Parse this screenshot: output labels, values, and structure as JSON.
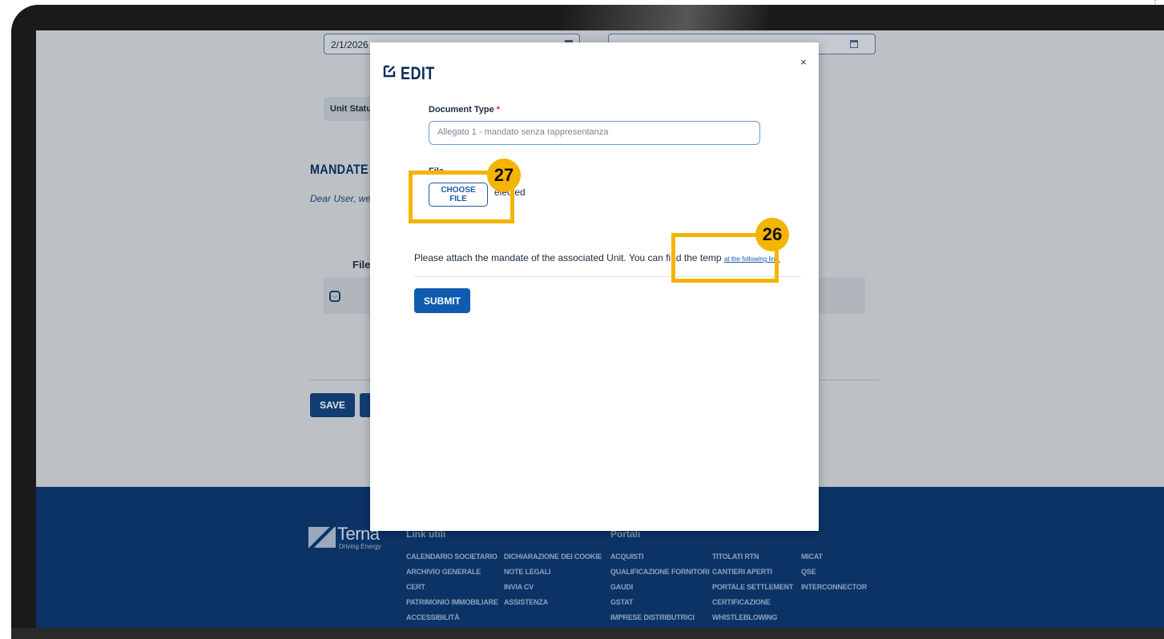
{
  "background_page": {
    "date_from": "2/1/2026",
    "unit_status_label": "Unit Status:",
    "mandate_title": "MANDATE",
    "mandate_note": "Dear User, werem",
    "table_col_file": "File",
    "save_label": "SAVE"
  },
  "modal": {
    "title": "EDIT",
    "close_glyph": "×",
    "document_type_label": "Document Type",
    "required_mark": "*",
    "document_type_value": "Allegato 1 - mandato senza rappresentanza",
    "file_label": "File",
    "choose_file_label": "CHOOSE FILE",
    "no_file_text": "elected",
    "hint_text": "Please attach the mandate of the associated Unit. You can find the temp",
    "hint_link_text": "at the following link.",
    "submit_label": "SUBMIT"
  },
  "annotations": [
    {
      "number": "27",
      "color": "#f5b400"
    },
    {
      "number": "26",
      "color": "#f5b400"
    }
  ],
  "footer": {
    "brand": "Terna",
    "tagline": "Driving Energy",
    "col1_head": "Link utili",
    "col2_head": "Portali",
    "links_col1": [
      "CALENDARIO SOCIETARIO",
      "ARCHIVIO GENERALE",
      "CERT",
      "PATRIMONIO IMMOBILIARE",
      "ACCESSIBILITÀ"
    ],
    "links_col2": [
      "DICHIARAZIONE DEI COOKIE",
      "NOTE LEGALI",
      "INVIA CV",
      "ASSISTENZA"
    ],
    "links_col3": [
      "ACQUISTI",
      "QUALIFICAZIONE FORNITORI",
      "GAUDI",
      "GSTAT",
      "IMPRESE DISTRIBUTRICI"
    ],
    "links_col4": [
      "TITOLATI RTN",
      "CANTIERI APERTI",
      "PORTALE SETTLEMENT",
      "CERTIFICAZIONE",
      "WHISTLEBLOWING"
    ],
    "links_col5": [
      "MICAT",
      "QSE",
      "INTERCONNECTOR"
    ]
  },
  "colors": {
    "brand_navy": "#0b3366",
    "accent_blue": "#0f5bb0",
    "callout_yellow": "#f5b400"
  }
}
